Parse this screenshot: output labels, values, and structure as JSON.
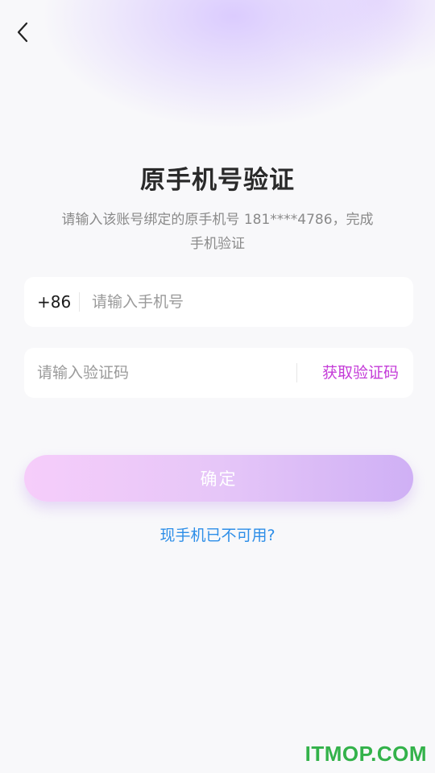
{
  "header": {
    "back_icon": "chevron-left-icon"
  },
  "page": {
    "title": "原手机号验证",
    "subtitle": "请输入该账号绑定的原手机号 181****4786，完成手机验证"
  },
  "phone_field": {
    "country_code": "+86",
    "placeholder": "请输入手机号",
    "value": ""
  },
  "code_field": {
    "placeholder": "请输入验证码",
    "value": "",
    "get_code_label": "获取验证码"
  },
  "actions": {
    "confirm_label": "确定",
    "unavailable_link": "现手机已不可用?"
  },
  "watermark": {
    "text": "ITMOP.COM"
  },
  "colors": {
    "accent": "#c43bd8",
    "link": "#2d8ee8",
    "button_gradient_start": "#f6cdfa",
    "button_gradient_end": "#cfb0f5"
  }
}
